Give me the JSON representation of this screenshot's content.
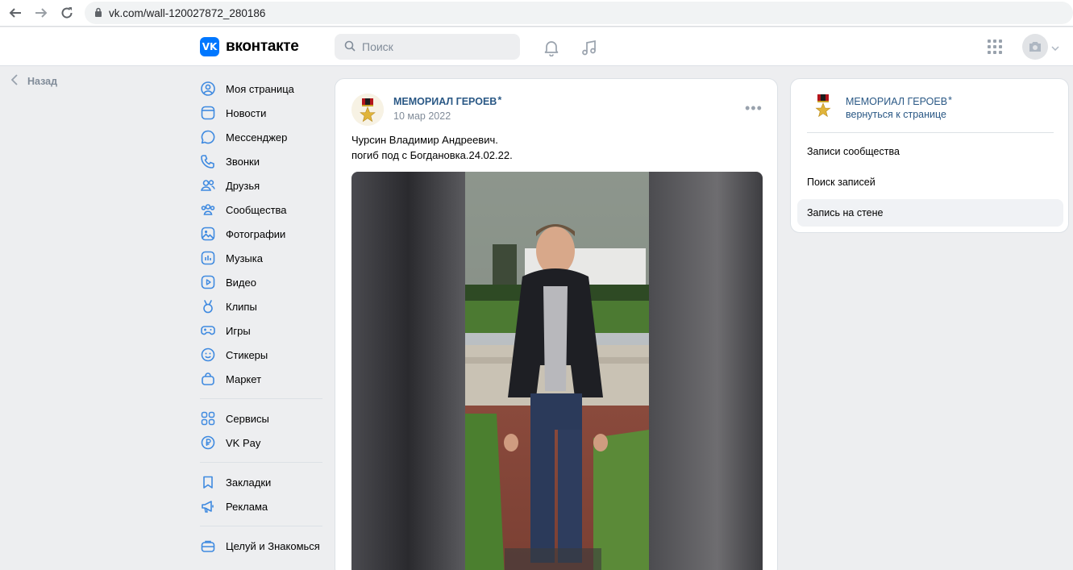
{
  "browser": {
    "url": "vk.com/wall-120027872_280186"
  },
  "header": {
    "logo_text": "вконтакте",
    "logo_mark": "VK",
    "search_placeholder": "Поиск"
  },
  "back_label": "Назад",
  "menu": {
    "groups": [
      [
        {
          "label": "Моя страница",
          "icon": "user-circle-icon"
        },
        {
          "label": "Новости",
          "icon": "newsfeed-icon"
        },
        {
          "label": "Мессенджер",
          "icon": "message-icon"
        },
        {
          "label": "Звонки",
          "icon": "phone-icon"
        },
        {
          "label": "Друзья",
          "icon": "friends-icon"
        },
        {
          "label": "Сообщества",
          "icon": "communities-icon"
        },
        {
          "label": "Фотографии",
          "icon": "photo-icon"
        },
        {
          "label": "Музыка",
          "icon": "music-icon"
        },
        {
          "label": "Видео",
          "icon": "video-icon"
        },
        {
          "label": "Клипы",
          "icon": "clips-icon"
        },
        {
          "label": "Игры",
          "icon": "gamepad-icon"
        },
        {
          "label": "Стикеры",
          "icon": "smile-icon"
        },
        {
          "label": "Маркет",
          "icon": "market-bag-icon"
        }
      ],
      [
        {
          "label": "Сервисы",
          "icon": "services-grid-icon"
        },
        {
          "label": "VK Pay",
          "icon": "vkpay-icon"
        }
      ],
      [
        {
          "label": "Закладки",
          "icon": "bookmark-icon"
        },
        {
          "label": "Реклама",
          "icon": "megaphone-icon"
        }
      ],
      [
        {
          "label": "Целуй и Знакомься",
          "icon": "briefcase-icon"
        }
      ]
    ]
  },
  "post": {
    "author": "МЕМОРИАЛ ГЕРОЕВ ⃰",
    "date": "10 мар 2022",
    "text_line1": "Чурсин Владимир Андреевич.",
    "text_line2": "погиб под с Богдановка.24.02.22."
  },
  "side": {
    "name": "МЕМОРИАЛ ГЕРОЕВ ⃰",
    "back_link": "вернуться к странице",
    "items": [
      {
        "label": "Записи сообщества",
        "active": false
      },
      {
        "label": "Поиск записей",
        "active": false
      },
      {
        "label": "Запись на стене",
        "active": true
      }
    ]
  }
}
